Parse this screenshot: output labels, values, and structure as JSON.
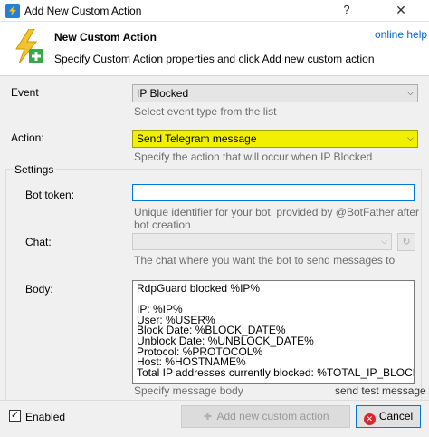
{
  "window": {
    "title": "Add New Custom Action",
    "help_glyph": "?",
    "close_glyph": "✕"
  },
  "header": {
    "title": "New Custom Action",
    "subtitle": "Specify Custom Action properties and click Add new custom action",
    "online_help": "online help"
  },
  "event": {
    "label": "Event",
    "value": "IP Blocked",
    "hint": "Select event type from the list"
  },
  "action": {
    "label": "Action:",
    "value": "Send Telegram message",
    "hint": "Specify the action that will occur when IP Blocked",
    "highlight_color": "#f0f000"
  },
  "settings": {
    "group_title": "Settings",
    "bot_token": {
      "label": "Bot token:",
      "value": "",
      "hint": "Unique identifier for your bot, provided by @BotFather after bot creation"
    },
    "chat": {
      "label": "Chat:",
      "value": "",
      "hint": "The chat where you want the bot to send messages to"
    },
    "body": {
      "label": "Body:",
      "lines": [
        "RdpGuard blocked %IP%",
        "",
        "IP: %IP%",
        "User: %USER%",
        "Block Date: %BLOCK_DATE%",
        "Unblock Date: %UNBLOCK_DATE%",
        "Protocol: %PROTOCOL%",
        "Host: %HOSTNAME%",
        "Total IP addresses currently blocked: %TOTAL_IP_BLOCKED%"
      ],
      "hint": "Specify message body",
      "send_test": "send test message"
    }
  },
  "footer": {
    "enabled_label": "Enabled",
    "enabled_checked": true,
    "add_button": "Add new custom action",
    "cancel_button": "Cancel"
  }
}
